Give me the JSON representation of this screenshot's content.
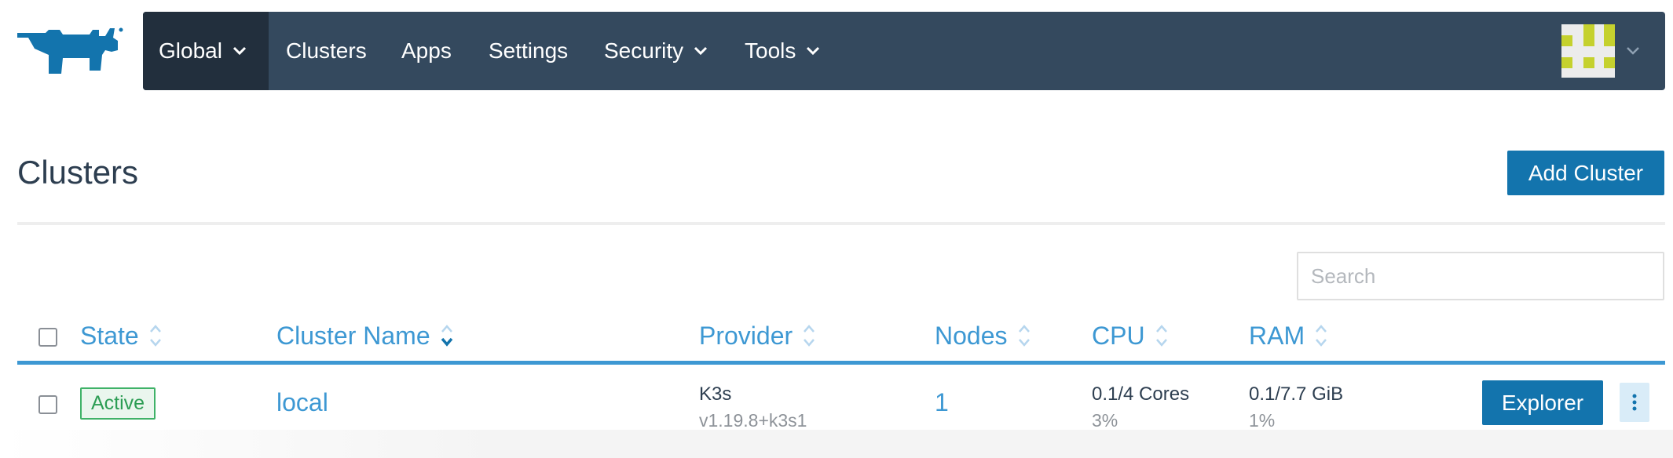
{
  "brand": {
    "logo_icon": "rancher-bull-logo",
    "color": "#1374ad"
  },
  "nav": {
    "items": [
      {
        "label": "Global",
        "has_dropdown": true,
        "active": true
      },
      {
        "label": "Clusters",
        "has_dropdown": false,
        "active": false
      },
      {
        "label": "Apps",
        "has_dropdown": false,
        "active": false
      },
      {
        "label": "Settings",
        "has_dropdown": false,
        "active": false
      },
      {
        "label": "Security",
        "has_dropdown": true,
        "active": false
      },
      {
        "label": "Tools",
        "has_dropdown": true,
        "active": false
      }
    ],
    "background": "#34495e",
    "active_background": "#222f3d"
  },
  "user_menu": {
    "avatar_icon": "identicon-avatar",
    "chevron_icon": "chevron-down-icon"
  },
  "page": {
    "title": "Clusters",
    "add_button_label": "Add Cluster"
  },
  "search": {
    "placeholder": "Search",
    "value": ""
  },
  "table": {
    "columns": [
      {
        "label": "State",
        "sort_icon": "sort-both-icon"
      },
      {
        "label": "Cluster Name",
        "sort_icon": "sort-desc-icon"
      },
      {
        "label": "Provider",
        "sort_icon": "sort-both-icon"
      },
      {
        "label": "Nodes",
        "sort_icon": "sort-both-icon"
      },
      {
        "label": "CPU",
        "sort_icon": "sort-both-icon"
      },
      {
        "label": "RAM",
        "sort_icon": "sort-both-icon"
      }
    ],
    "rows": [
      {
        "state": "Active",
        "name": "local",
        "provider": "K3s",
        "provider_version": "v1.19.8+k3s1",
        "nodes": "1",
        "cpu": "0.1/4 Cores",
        "cpu_pct": "3%",
        "ram": "0.1/7.7 GiB",
        "ram_pct": "1%",
        "action_label": "Explorer"
      }
    ]
  },
  "colors": {
    "primary": "#1374ad",
    "link": "#3d98d3",
    "active_badge": "#2c9d54"
  }
}
